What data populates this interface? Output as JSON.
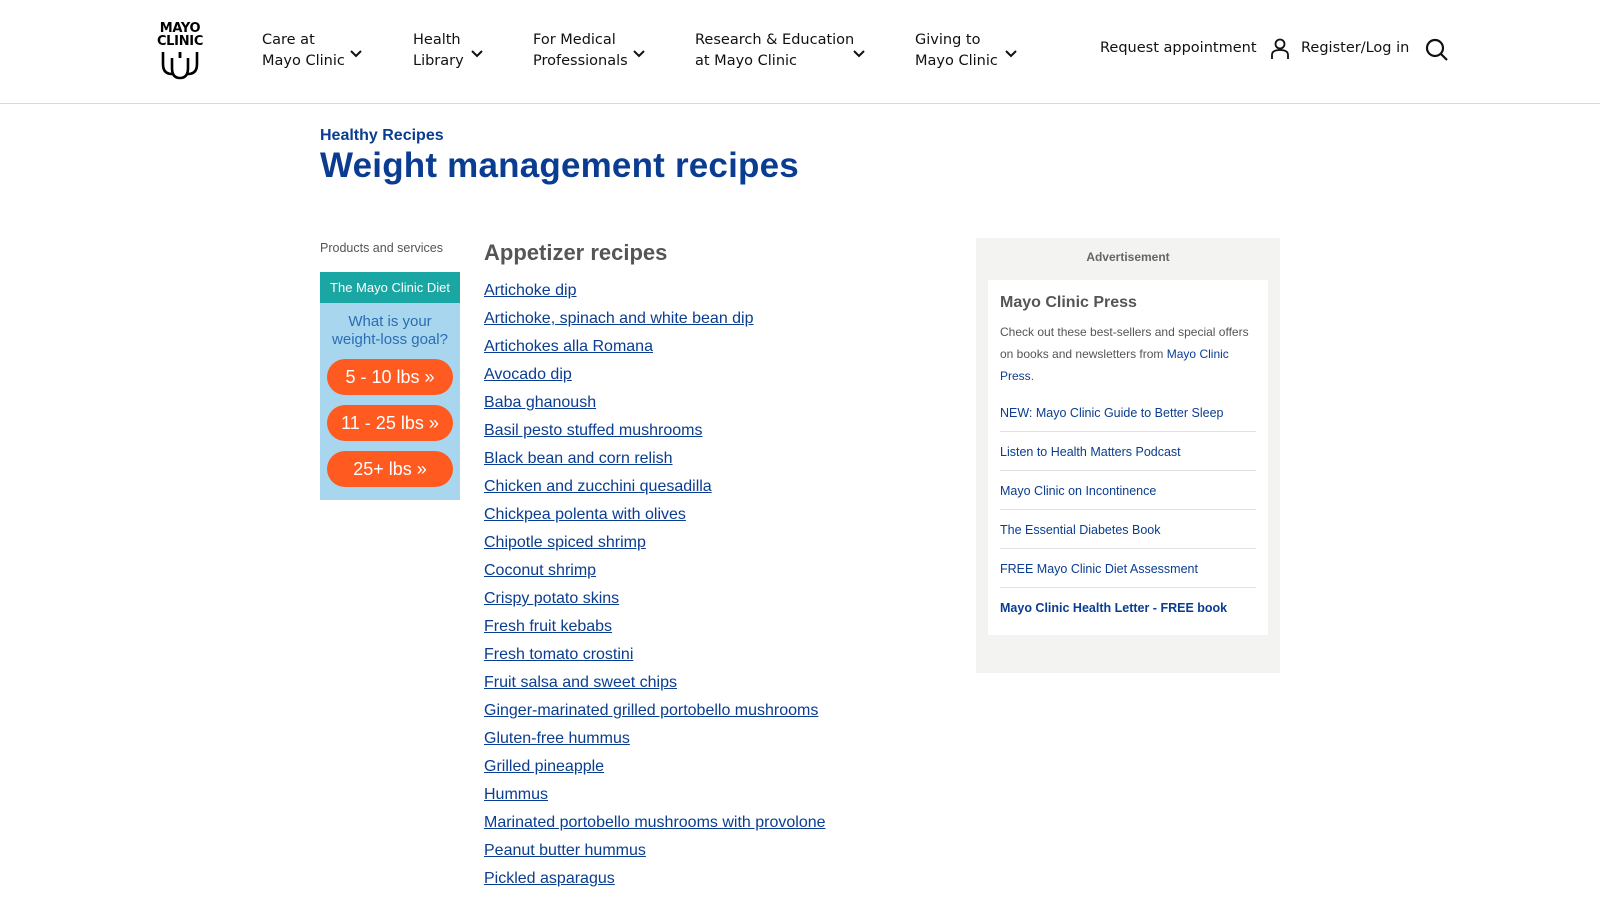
{
  "header": {
    "logo": {
      "line1": "MAYO",
      "line2": "CLINIC"
    },
    "nav": [
      {
        "line1": "Care at",
        "line2": "Mayo Clinic"
      },
      {
        "line1": "Health",
        "line2": "Library"
      },
      {
        "line1": "For Medical",
        "line2": "Professionals"
      },
      {
        "line1": "Research & Education",
        "line2": "at Mayo Clinic"
      },
      {
        "line1": "Giving to",
        "line2": "Mayo Clinic"
      }
    ],
    "request_appointment": "Request appointment",
    "register_login": "Register/Log in"
  },
  "page": {
    "eyebrow": "Healthy Recipes",
    "title": "Weight management recipes"
  },
  "left_ad": {
    "label": "Products and services",
    "banner": "The Mayo Clinic Diet",
    "question_line1": "What is your",
    "question_line2": "weight-loss goal?",
    "options": [
      "5 - 10 lbs »",
      "11 - 25 lbs »",
      "25+ lbs »"
    ]
  },
  "recipes": {
    "heading": "Appetizer recipes",
    "items": [
      "Artichoke dip",
      "Artichoke, spinach and white bean dip",
      "Artichokes alla Romana",
      "Avocado dip",
      "Baba ghanoush",
      "Basil pesto stuffed mushrooms",
      "Black bean and corn relish",
      "Chicken and zucchini quesadilla",
      "Chickpea polenta with olives",
      "Chipotle spiced shrimp",
      "Coconut shrimp",
      "Crispy potato skins",
      "Fresh fruit kebabs",
      "Fresh tomato crostini",
      "Fruit salsa and sweet chips",
      "Ginger-marinated grilled portobello mushrooms",
      "Gluten-free hummus",
      "Grilled pineapple",
      "Hummus",
      "Marinated portobello mushrooms with provolone",
      "Peanut butter hummus",
      "Pickled asparagus"
    ]
  },
  "right_ad": {
    "label": "Advertisement",
    "heading": "Mayo Clinic Press",
    "desc_text": "Check out these best-sellers and special offers on books and newsletters from ",
    "desc_link": "Mayo Clinic Press",
    "desc_end": ".",
    "links": [
      "NEW: Mayo Clinic Guide to Better Sleep",
      "Listen to Health Matters Podcast",
      "Mayo Clinic on Incontinence",
      "The Essential Diabetes Book",
      "FREE Mayo Clinic Diet Assessment",
      "Mayo Clinic Health Letter - FREE book"
    ]
  },
  "colors": {
    "brand_blue": "#0a3d91",
    "diet_teal": "#1aa7a3",
    "diet_orange": "#ff5a1f",
    "diet_light_blue": "#a9d6ef"
  }
}
